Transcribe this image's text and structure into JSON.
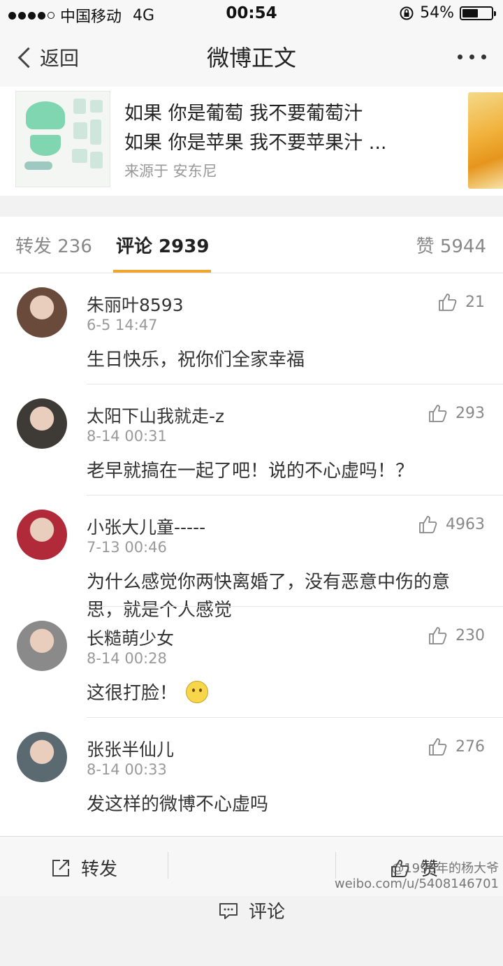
{
  "status_bar": {
    "carrier": "中国移动",
    "network": "4G",
    "time": "00:54",
    "battery": "54%",
    "battery_level": 0.54
  },
  "nav": {
    "back_label": "返回",
    "title": "微博正文"
  },
  "post_card": {
    "line1": "如果 你是葡萄 我不要葡萄汁",
    "line2": "如果 你是苹果 我不要苹果汁 ...",
    "source": "来源于 安东尼"
  },
  "tabs": {
    "repost": "转发 236",
    "comments": "评论 2939",
    "likes": "赞 5944"
  },
  "comments": [
    {
      "name": "朱丽叶8593",
      "time": "6-5 14:47",
      "text": "生日快乐，祝你们全家幸福",
      "likes": "21",
      "avatar_color": "#6a4a3a"
    },
    {
      "name": "太阳下山我就走-z",
      "time": "8-14 00:31",
      "text": "老早就搞在一起了吧！说的不心虚吗！？",
      "likes": "293",
      "avatar_color": "#3e3a36"
    },
    {
      "name": "小张大儿童-----",
      "time": "7-13 00:46",
      "text": "为什么感觉你两快离婚了，没有恶意中伤的意思，就是个人感觉",
      "likes": "4963",
      "avatar_color": "#b02a3a"
    },
    {
      "name": "长糙萌少女",
      "time": "8-14 00:28",
      "text": "这很打脸！",
      "likes": "230",
      "avatar_color": "#8a8a8a"
    },
    {
      "name": "张张半仙儿",
      "time": "8-14 00:33",
      "text": "发这样的微博不心虚吗",
      "likes": "276",
      "avatar_color": "#5a6a70"
    }
  ],
  "toolbar": {
    "repost": "转发",
    "comment": "评论",
    "like": "赞"
  },
  "watermark": {
    "line1": "@1996年的杨大爷",
    "line2": "weibo.com/u/5408146701"
  }
}
